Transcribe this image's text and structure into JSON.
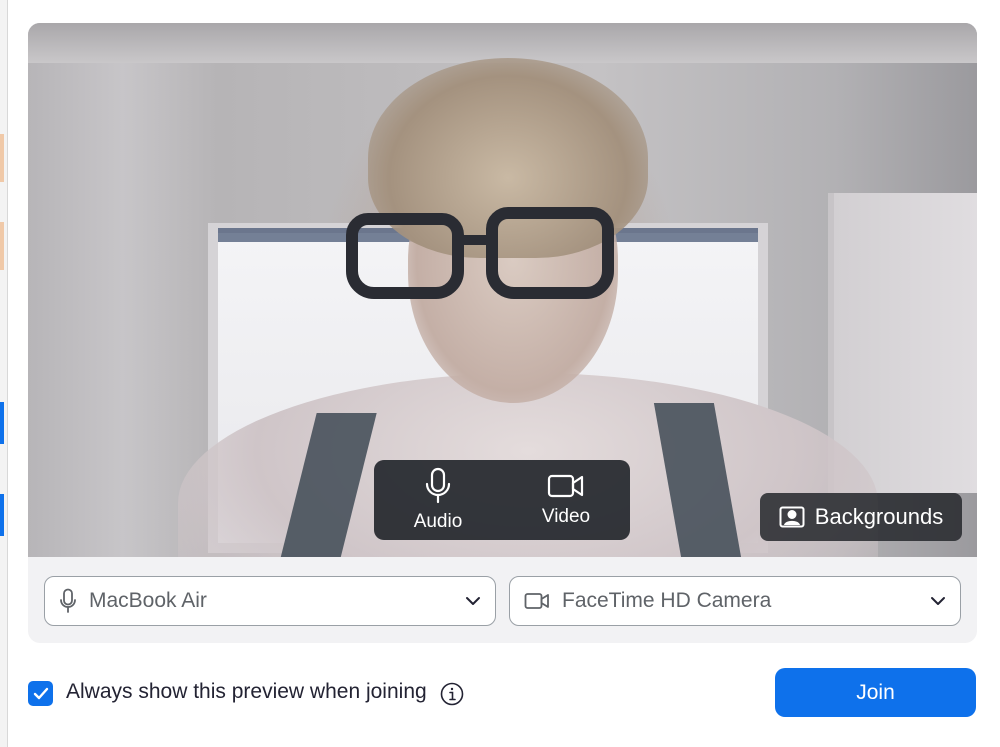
{
  "controls": {
    "audio_label": "Audio",
    "video_label": "Video",
    "backgrounds_label": "Backgrounds"
  },
  "devices": {
    "microphone": "MacBook Air",
    "camera": "FaceTime HD Camera"
  },
  "options": {
    "always_show_preview_label": "Always show this preview when joining",
    "always_show_preview_checked": true
  },
  "join": {
    "label": "Join"
  },
  "colors": {
    "accent": "#0e71eb",
    "overlay": "#24272c"
  },
  "icons": [
    "microphone-icon",
    "video-camera-icon",
    "backgrounds-icon",
    "chevron-down-icon",
    "checkmark-icon",
    "info-icon"
  ]
}
